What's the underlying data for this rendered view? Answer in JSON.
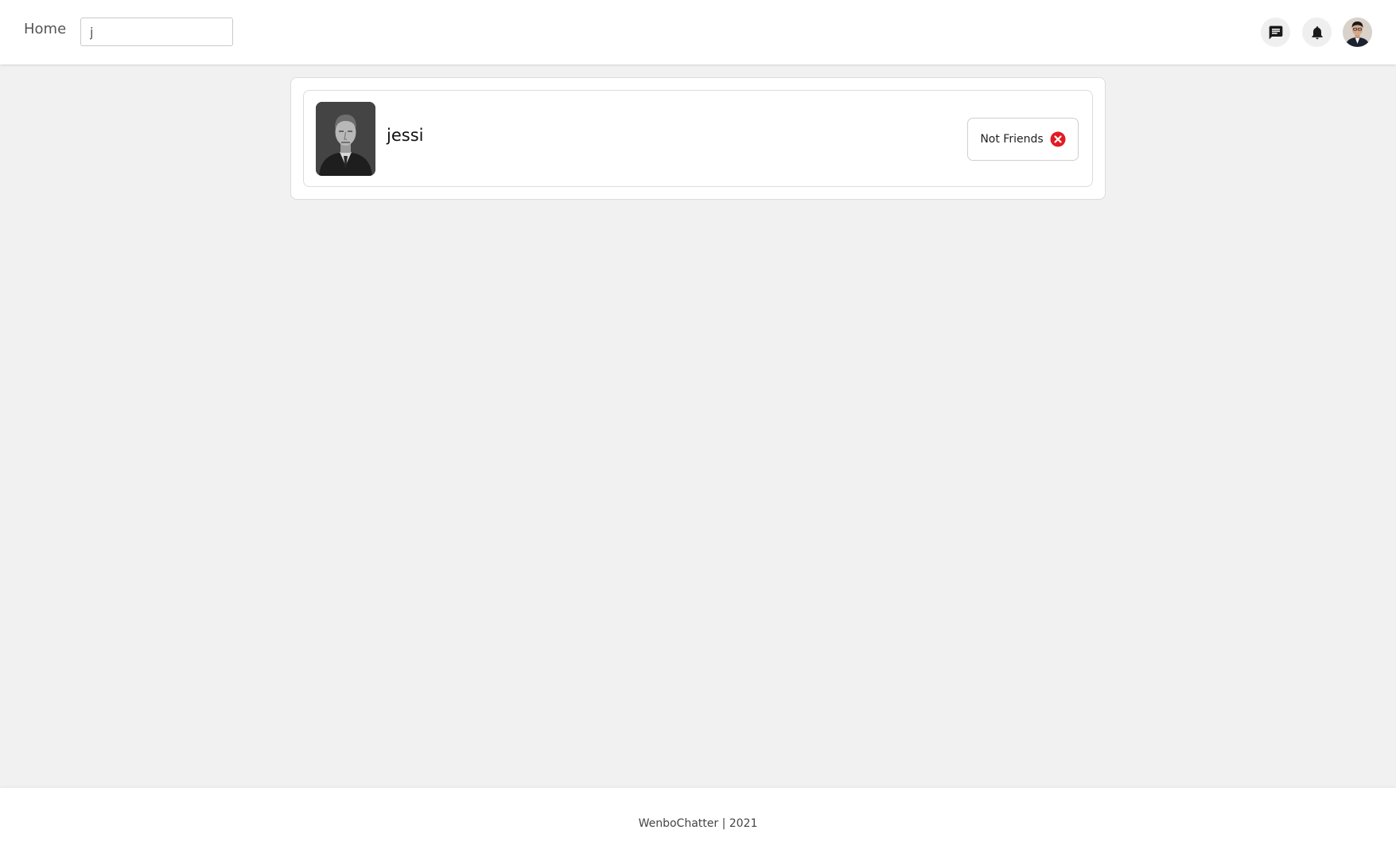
{
  "header": {
    "home_label": "Home",
    "search": {
      "value": "j",
      "placeholder": ""
    },
    "icons": {
      "messages": "chat-icon",
      "notifications": "bell-icon",
      "profile": "avatar"
    }
  },
  "results": [
    {
      "name": "jessi",
      "status_label": "Not Friends",
      "status_icon": "close-circle-icon",
      "status_color": "#e21b23"
    }
  ],
  "footer": {
    "text": "WenboChatter | 2021"
  },
  "colors": {
    "page_bg": "#f1f1f1",
    "surface": "#ffffff",
    "status_red": "#e21b23"
  }
}
